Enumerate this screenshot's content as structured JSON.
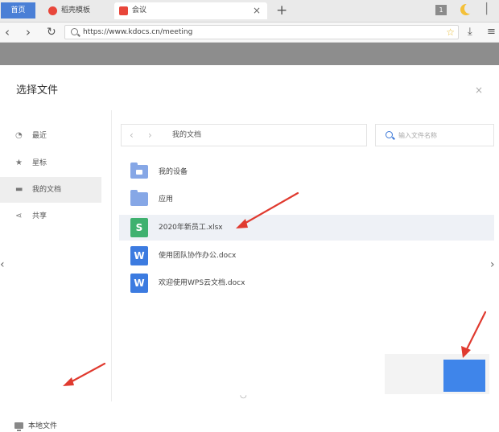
{
  "browser": {
    "tabs": [
      {
        "label": "首页"
      },
      {
        "label": "稻壳模板"
      },
      {
        "label": "会议"
      }
    ],
    "close_label": "×",
    "new_tab_label": "+",
    "window_btn_label": "1",
    "url": "https://www.kdocs.cn/meeting",
    "icons": {
      "back": "‹",
      "forward": "›",
      "reload": "↻",
      "star": "☆",
      "download": "⤓",
      "menu": "≡"
    }
  },
  "dialog": {
    "title": "选择文件",
    "close_label": "×",
    "sidebar": {
      "items": [
        {
          "icon": "◔",
          "label": "最近"
        },
        {
          "icon": "★",
          "label": "星标"
        },
        {
          "icon": "▬",
          "label": "我的文档"
        },
        {
          "icon": "⋖",
          "label": "共享"
        }
      ],
      "local_file_label": "本地文件"
    },
    "breadcrumb": {
      "back": "‹",
      "forward": "›",
      "path": "我的文档"
    },
    "search": {
      "placeholder": "输入文件名称"
    },
    "files": [
      {
        "name": "我的设备",
        "type": "folder"
      },
      {
        "name": "应用",
        "type": "folder"
      },
      {
        "name": "2020年新员工.xlsx",
        "type": "sheet",
        "icon_letter": "S"
      },
      {
        "name": "使用团队协作办公.docx",
        "type": "doc",
        "icon_letter": "W"
      },
      {
        "name": "欢迎使用WPS云文档.docx",
        "type": "doc",
        "icon_letter": "W"
      }
    ],
    "edge_left": "‹",
    "edge_right": "›",
    "bottom_mark": "◡"
  },
  "colors": {
    "accent": "#3f85ea",
    "annotation": "#e03a2f",
    "sheet_icon": "#3fb16f",
    "doc_icon": "#3c7be0",
    "folder": "#86a7e6"
  }
}
